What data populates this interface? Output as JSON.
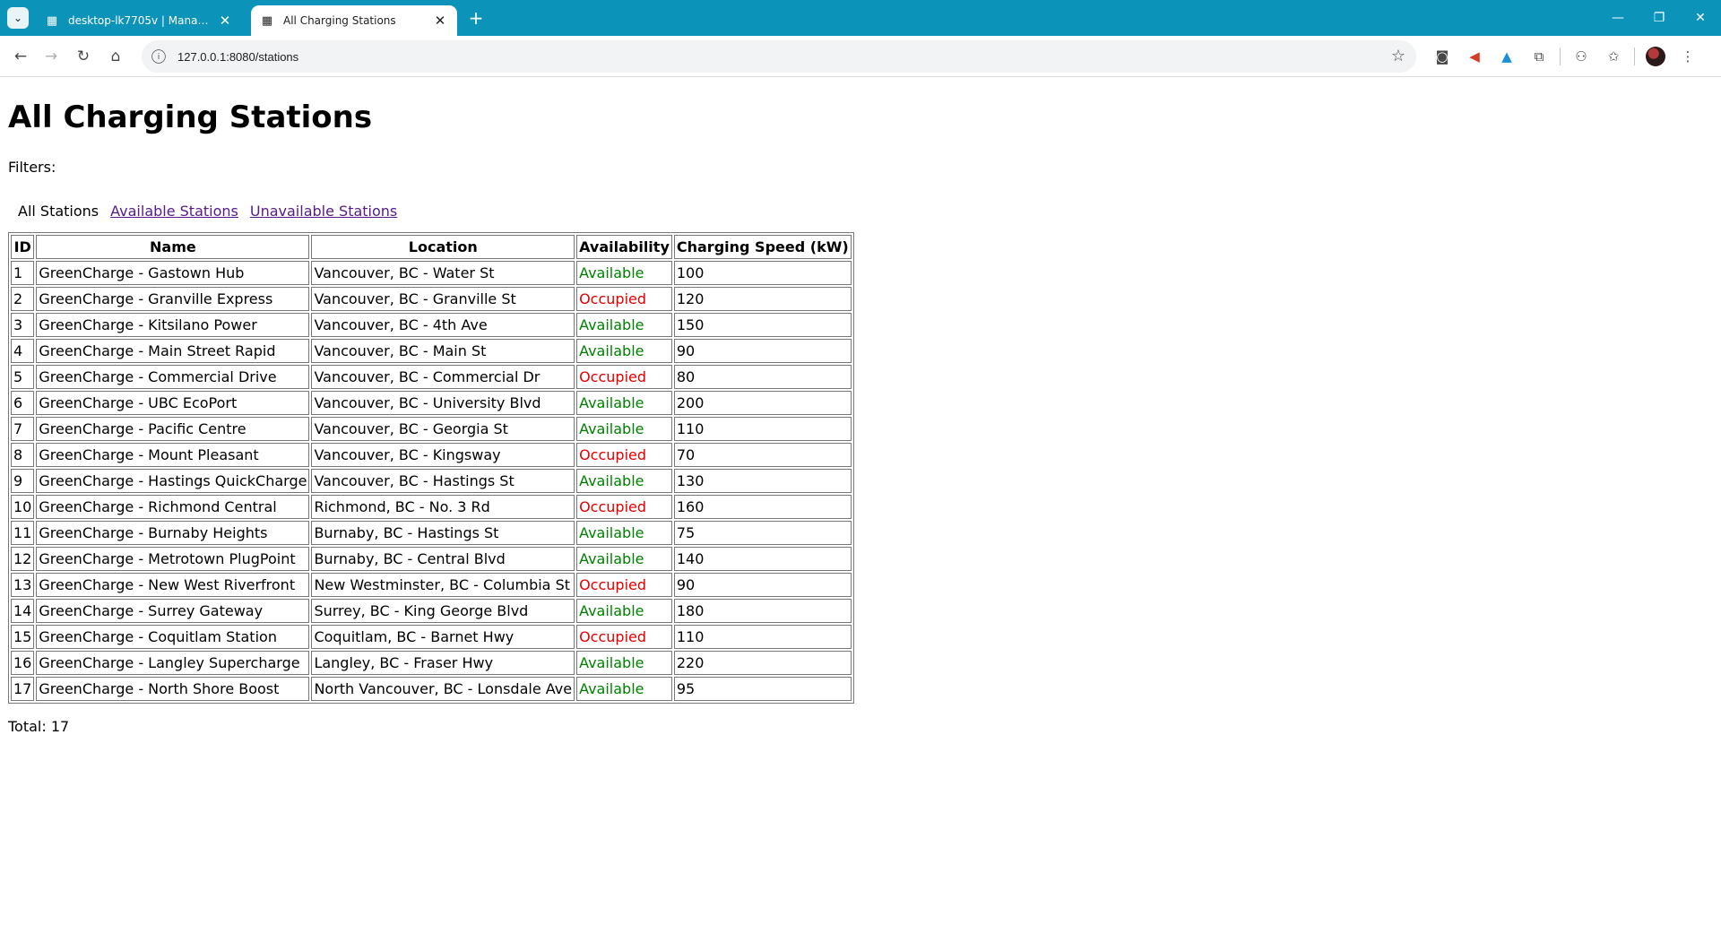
{
  "browser": {
    "tabs": [
      {
        "title": "desktop-lk7705v | Management",
        "active": false
      },
      {
        "title": "All Charging Stations",
        "active": true
      }
    ],
    "url": "127.0.0.1:8080/stations"
  },
  "page": {
    "title": "All Charging Stations",
    "filters_label": "Filters:",
    "filters": {
      "all": "All Stations",
      "available": "Available Stations",
      "unavailable": "Unavailable Stations"
    },
    "table": {
      "headers": [
        "ID",
        "Name",
        "Location",
        "Availability",
        "Charging Speed (kW)"
      ],
      "rows": [
        [
          "1",
          "GreenCharge - Gastown Hub",
          "Vancouver, BC - Water St",
          "Available",
          "100"
        ],
        [
          "2",
          "GreenCharge - Granville Express",
          "Vancouver, BC - Granville St",
          "Occupied",
          "120"
        ],
        [
          "3",
          "GreenCharge - Kitsilano Power",
          "Vancouver, BC - 4th Ave",
          "Available",
          "150"
        ],
        [
          "4",
          "GreenCharge - Main Street Rapid",
          "Vancouver, BC - Main St",
          "Available",
          "90"
        ],
        [
          "5",
          "GreenCharge - Commercial Drive",
          "Vancouver, BC - Commercial Dr",
          "Occupied",
          "80"
        ],
        [
          "6",
          "GreenCharge - UBC EcoPort",
          "Vancouver, BC - University Blvd",
          "Available",
          "200"
        ],
        [
          "7",
          "GreenCharge - Pacific Centre",
          "Vancouver, BC - Georgia St",
          "Available",
          "110"
        ],
        [
          "8",
          "GreenCharge - Mount Pleasant",
          "Vancouver, BC - Kingsway",
          "Occupied",
          "70"
        ],
        [
          "9",
          "GreenCharge - Hastings QuickCharge",
          "Vancouver, BC - Hastings St",
          "Available",
          "130"
        ],
        [
          "10",
          "GreenCharge - Richmond Central",
          "Richmond, BC - No. 3 Rd",
          "Occupied",
          "160"
        ],
        [
          "11",
          "GreenCharge - Burnaby Heights",
          "Burnaby, BC - Hastings St",
          "Available",
          "75"
        ],
        [
          "12",
          "GreenCharge - Metrotown PlugPoint",
          "Burnaby, BC - Central Blvd",
          "Available",
          "140"
        ],
        [
          "13",
          "GreenCharge - New West Riverfront",
          "New Westminster, BC - Columbia St",
          "Occupied",
          "90"
        ],
        [
          "14",
          "GreenCharge - Surrey Gateway",
          "Surrey, BC - King George Blvd",
          "Available",
          "180"
        ],
        [
          "15",
          "GreenCharge - Coquitlam Station",
          "Coquitlam, BC - Barnet Hwy",
          "Occupied",
          "110"
        ],
        [
          "16",
          "GreenCharge - Langley Supercharge",
          "Langley, BC - Fraser Hwy",
          "Available",
          "220"
        ],
        [
          "17",
          "GreenCharge - North Shore Boost",
          "North Vancouver, BC - Lonsdale Ave",
          "Available",
          "95"
        ]
      ]
    },
    "total": "Total: 17"
  },
  "colors": {
    "tabbar": "#0b93b9",
    "available": "#008000",
    "occupied": "#e60000",
    "visited_link": "#551a8b"
  }
}
